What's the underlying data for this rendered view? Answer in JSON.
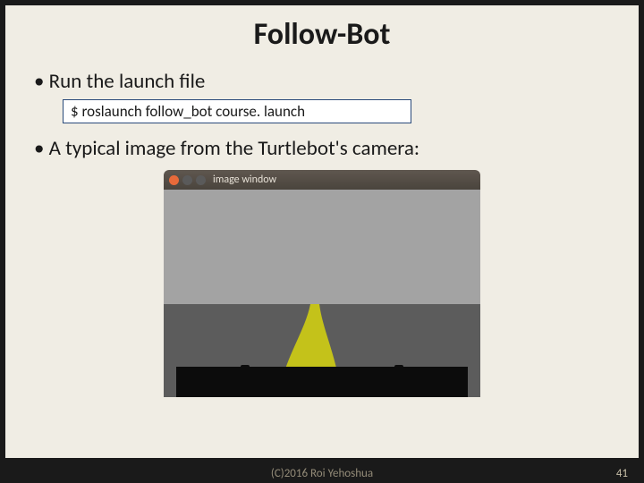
{
  "title": "Follow-Bot",
  "bullets": {
    "b1": "Run the launch file",
    "b2": "A typical image from the Turtlebot's camera:"
  },
  "code": "$ roslaunch follow_bot course. launch",
  "window": {
    "title": "image window"
  },
  "footer": {
    "copyright": "(C)2016 Roi Yehoshua",
    "page": "41"
  }
}
